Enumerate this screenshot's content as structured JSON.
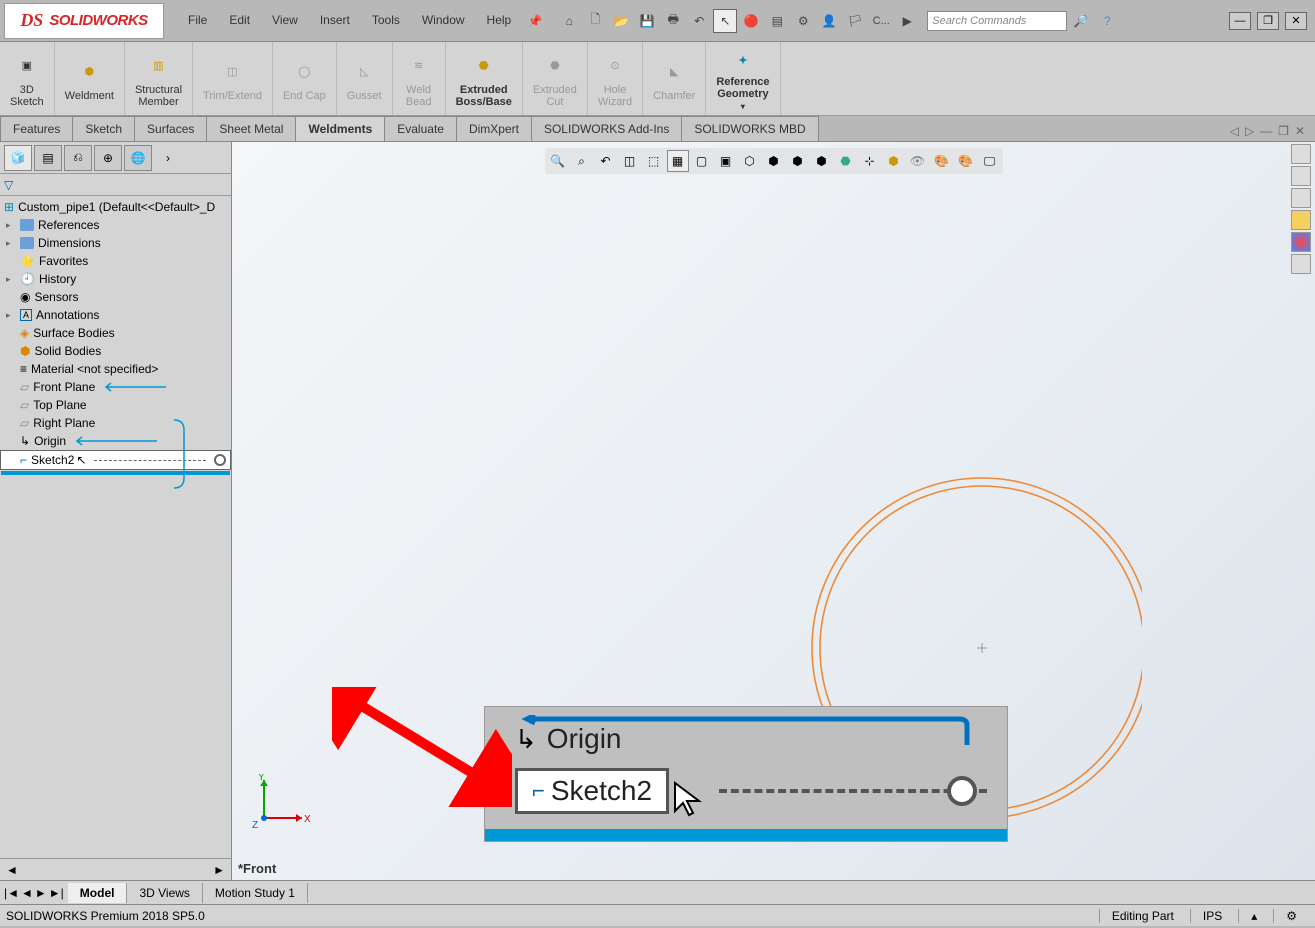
{
  "app": {
    "logo_text": "SOLIDWORKS"
  },
  "menu": {
    "file": "File",
    "edit": "Edit",
    "view": "View",
    "insert": "Insert",
    "tools": "Tools",
    "window": "Window",
    "help": "Help"
  },
  "title_extra": {
    "c_label": "C..."
  },
  "search": {
    "placeholder": "Search Commands"
  },
  "ribbon": {
    "sketch3d": "3D\nSketch",
    "weldment": "Weldment",
    "structural": "Structural\nMember",
    "trim": "Trim/Extend",
    "endcap": "End Cap",
    "gusset": "Gusset",
    "weldbead": "Weld\nBead",
    "extboss": "Extruded\nBoss/Base",
    "extcut": "Extruded\nCut",
    "hole": "Hole\nWizard",
    "chamfer": "Chamfer",
    "refgeo": "Reference\nGeometry"
  },
  "tabs": {
    "features": "Features",
    "sketch": "Sketch",
    "surfaces": "Surfaces",
    "sheetmetal": "Sheet Metal",
    "weldments": "Weldments",
    "evaluate": "Evaluate",
    "dimxpert": "DimXpert",
    "addins": "SOLIDWORKS Add-Ins",
    "mbd": "SOLIDWORKS MBD"
  },
  "tree": {
    "root": "Custom_pipe1 (Default<<Default>_D",
    "references": "References",
    "dimensions": "Dimensions",
    "favorites": "Favorites",
    "history": "History",
    "sensors": "Sensors",
    "annotations": "Annotations",
    "surfacebodies": "Surface Bodies",
    "solidbodies": "Solid Bodies",
    "material": "Material <not specified>",
    "frontplane": "Front Plane",
    "topplane": "Top Plane",
    "rightplane": "Right Plane",
    "origin": "Origin",
    "sketch2": "Sketch2"
  },
  "inset": {
    "origin": "Origin",
    "sketch": "Sketch2"
  },
  "viewport": {
    "front_label": "*Front",
    "axis_x": "X",
    "axis_y": "Y",
    "axis_z": "Z"
  },
  "bottom_tabs": {
    "model": "Model",
    "views3d": "3D Views",
    "motion": "Motion Study 1"
  },
  "status": {
    "product": "SOLIDWORKS Premium 2018 SP5.0",
    "editing": "Editing Part",
    "units": "IPS"
  }
}
